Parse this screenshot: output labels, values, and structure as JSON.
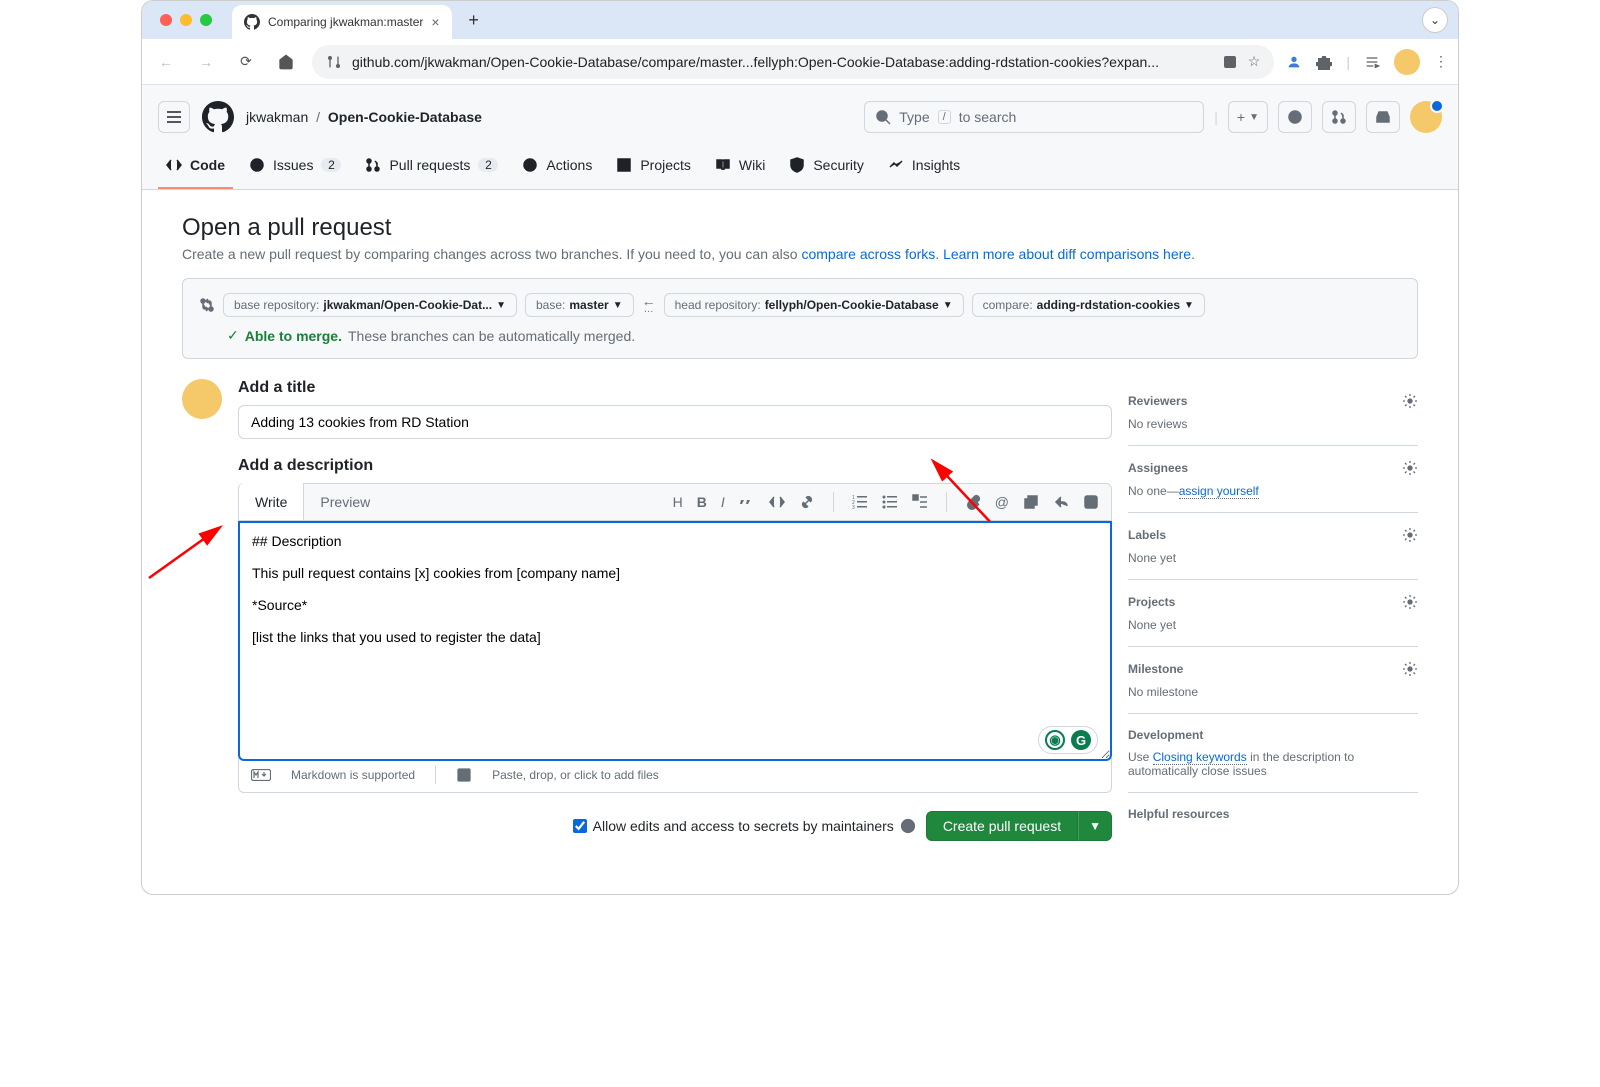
{
  "browser": {
    "tab_title": "Comparing jkwakman:master",
    "url": "github.com/jkwakman/Open-Cookie-Database/compare/master...fellyph:Open-Cookie-Database:adding-rdstation-cookies?expan..."
  },
  "header": {
    "owner": "jkwakman",
    "repo": "Open-Cookie-Database",
    "search_placeholder_pre": "Type",
    "search_key": "/",
    "search_placeholder_post": "to search"
  },
  "tabs": {
    "code": "Code",
    "issues": "Issues",
    "issues_count": "2",
    "pulls": "Pull requests",
    "pulls_count": "2",
    "actions": "Actions",
    "projects": "Projects",
    "wiki": "Wiki",
    "security": "Security",
    "insights": "Insights"
  },
  "page": {
    "title": "Open a pull request",
    "subtitle_pre": "Create a new pull request by comparing changes across two branches. If you need to, you can also ",
    "link1": "compare across forks",
    "sep": ". ",
    "link2": "Learn more about diff comparisons here",
    "dot": "."
  },
  "compare": {
    "base_repo_label": "base repository:",
    "base_repo_value": "jkwakman/Open-Cookie-Dat...",
    "base_label": "base:",
    "base_value": "master",
    "head_repo_label": "head repository:",
    "head_repo_value": "fellyph/Open-Cookie-Database",
    "compare_label": "compare:",
    "compare_value": "adding-rdstation-cookies",
    "able": "Able to merge.",
    "note": "These branches can be automatically merged."
  },
  "form": {
    "title_label": "Add a title",
    "title_value": "Adding 13 cookies from RD Station",
    "desc_label": "Add a description",
    "write_tab": "Write",
    "preview_tab": "Preview",
    "desc_value": "## Description\n\nThis pull request contains [x] cookies from [company name]\n\n*Source*\n\n[list the links that you used to register the data]",
    "markdown_note": "Markdown is supported",
    "paste_note": "Paste, drop, or click to add files",
    "allow_edits": "Allow edits and access to secrets by maintainers",
    "submit": "Create pull request"
  },
  "sidebar": {
    "reviewers": {
      "title": "Reviewers",
      "body": "No reviews"
    },
    "assignees": {
      "title": "Assignees",
      "body_pre": "No one—",
      "link": "assign yourself"
    },
    "labels": {
      "title": "Labels",
      "body": "None yet"
    },
    "projects": {
      "title": "Projects",
      "body": "None yet"
    },
    "milestone": {
      "title": "Milestone",
      "body": "No milestone"
    },
    "development": {
      "title": "Development",
      "body_pre": "Use ",
      "link": "Closing keywords",
      "body_post": " in the description to automatically close issues"
    },
    "resources": {
      "title": "Helpful resources"
    }
  }
}
